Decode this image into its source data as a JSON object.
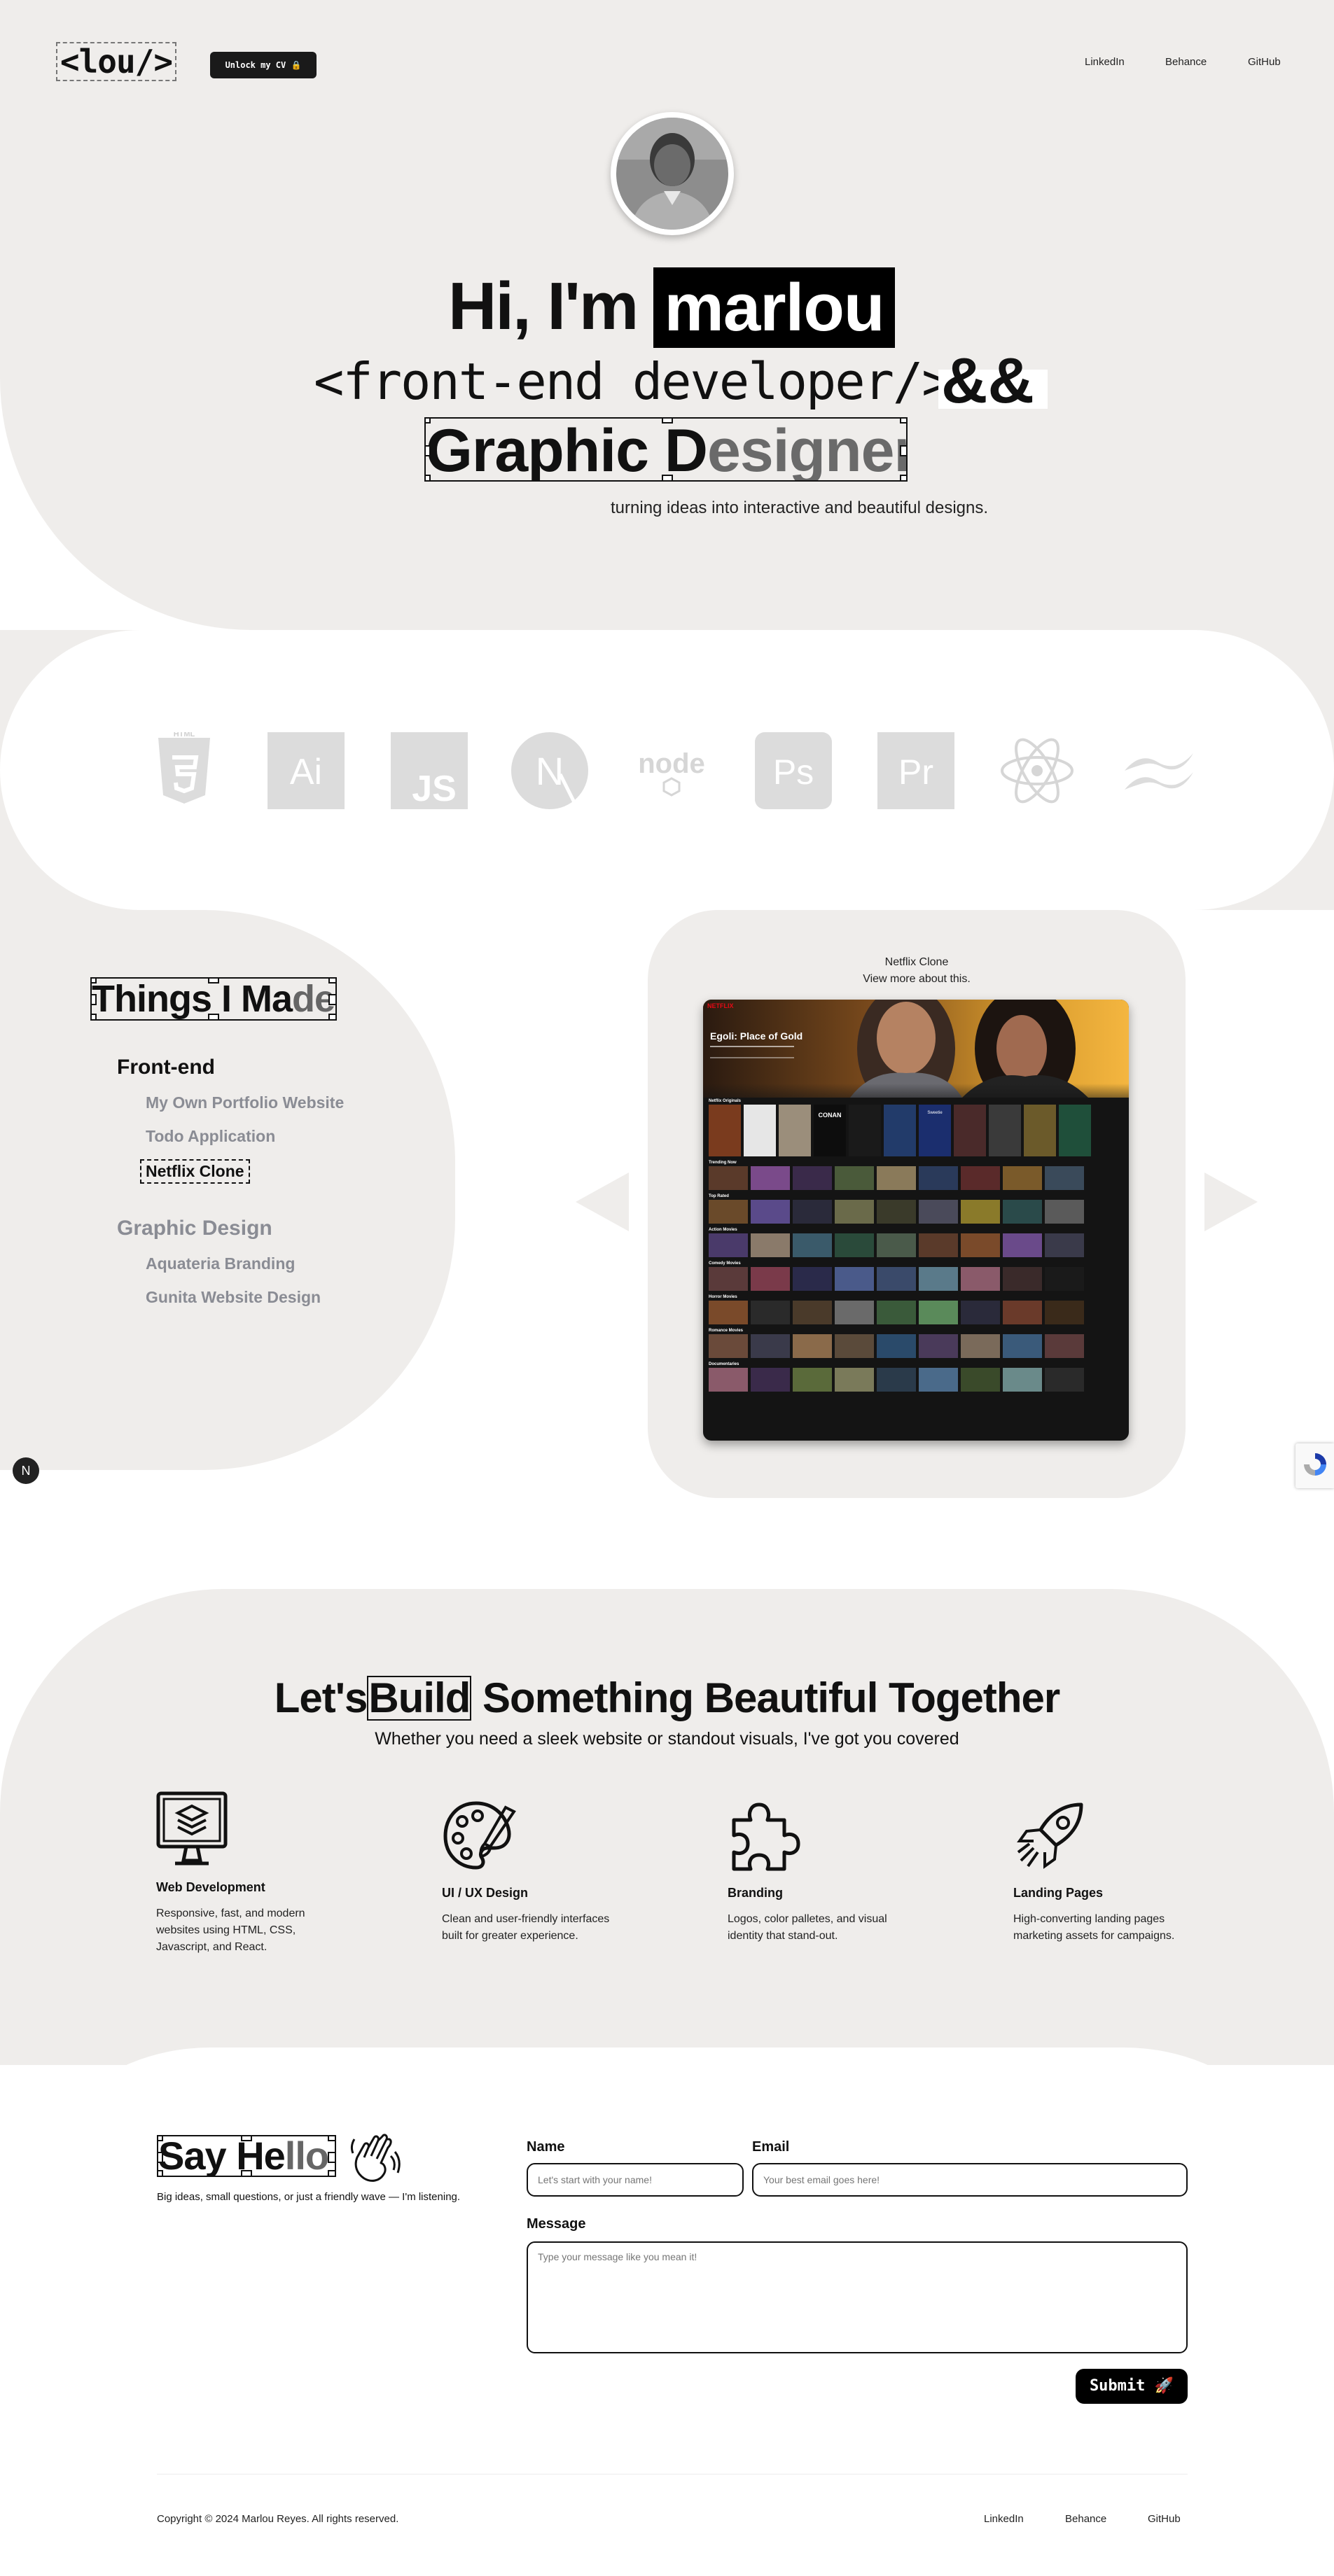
{
  "header": {
    "logo": "<lou/>",
    "cv_button": "Unlock my CV 🔒",
    "nav": [
      "LinkedIn",
      "Behance",
      "GitHub"
    ]
  },
  "hero": {
    "greeting": "Hi, I'm",
    "name": "marlou",
    "role_code": "<front-end developer/>",
    "ampersand": "&&",
    "role2_dark": "Graphic D",
    "role2_light": "esigner",
    "tagline": "turning ideas into interactive and beautiful designs."
  },
  "skills": [
    "html5-icon",
    "illustrator-icon",
    "javascript-icon",
    "nextjs-icon",
    "nodejs-icon",
    "photoshop-icon",
    "premiere-icon",
    "react-icon",
    "tailwind-icon"
  ],
  "skill_labels": {
    "html": "HTML",
    "ai": "Ai",
    "js": "JS",
    "n": "N",
    "node": "node",
    "ps": "Ps",
    "pr": "Pr"
  },
  "projects": {
    "title_dark": "Things I Ma",
    "title_light": "de",
    "categories": [
      {
        "label": "Front-end",
        "items": [
          "My Own Portfolio Website",
          "Todo Application",
          "Netflix Clone"
        ]
      },
      {
        "label": "Graphic Design",
        "items": [
          "Aquateria Branding",
          "Gunita Website Design"
        ]
      }
    ],
    "preview_title": "Netflix Clone",
    "preview_link": "View more about this.",
    "netflix": {
      "brand": "NETFLIX",
      "hero_title": "Egoli: Place of Gold",
      "rows": [
        "Netflix Originals",
        "Trending Now",
        "Top Rated",
        "Action Movies",
        "Comedy Movies",
        "Horror Movies",
        "Romance Movies",
        "Documentaries"
      ],
      "posters": [
        "CONAN",
        "Sweetie"
      ]
    },
    "badge": "N"
  },
  "services": {
    "title_left": "Let's",
    "title_box": "Build",
    "title_right": "Something Beautiful Together",
    "subtitle": "Whether you need a sleek website or standout visuals, I've got you covered",
    "items": [
      {
        "icon": "monitor-layers-icon",
        "title": "Web Development",
        "desc": "Responsive, fast, and modern websites using HTML, CSS, Javascript, and React."
      },
      {
        "icon": "palette-icon",
        "title": "UI / UX Design",
        "desc": "Clean and user-friendly interfaces built for greater experience."
      },
      {
        "icon": "puzzle-icon",
        "title": "Branding",
        "desc": "Logos, color palletes, and visual identity that stand-out."
      },
      {
        "icon": "rocket-icon",
        "title": "Landing Pages",
        "desc": "High-converting landing pages marketing assets for campaigns."
      }
    ]
  },
  "contact": {
    "title_dark": "Say He",
    "title_light": "llo",
    "subtitle": "Big ideas, small questions, or just a friendly wave — I'm listening.",
    "name_label": "Name",
    "name_placeholder": "Let's start with your name!",
    "email_label": "Email",
    "email_placeholder": "Your best email goes here!",
    "message_label": "Message",
    "message_placeholder": "Type your message like you mean it!",
    "submit": "Submit 🚀"
  },
  "footer": {
    "copyright": "Copyright © 2024 Marlou Reyes. All rights reserved.",
    "links": [
      "LinkedIn",
      "Behance",
      "GitHub"
    ]
  }
}
